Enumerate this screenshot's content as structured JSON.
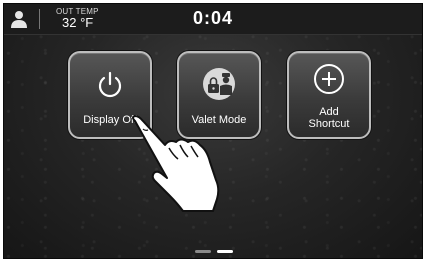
{
  "status_bar": {
    "out_temp_label": "OUT TEMP",
    "out_temp_value": "32 °F",
    "clock": "0:04"
  },
  "tiles": [
    {
      "label": "Display Off",
      "icon": "power-icon"
    },
    {
      "label": "Valet Mode",
      "icon": "valet-icon"
    },
    {
      "label_line1": "Add",
      "label_line2": "Shortcut",
      "icon": "add-shortcut-icon"
    }
  ],
  "pagination": {
    "pages": 2,
    "active": 2
  },
  "colors": {
    "background": "#262626",
    "tile_border": "#bdbdbd",
    "text": "#ffffff",
    "inactive_dot": "#8a8a8a",
    "active_dot": "#ffffff"
  },
  "overlay": {
    "icon": "pointing-hand-icon"
  }
}
